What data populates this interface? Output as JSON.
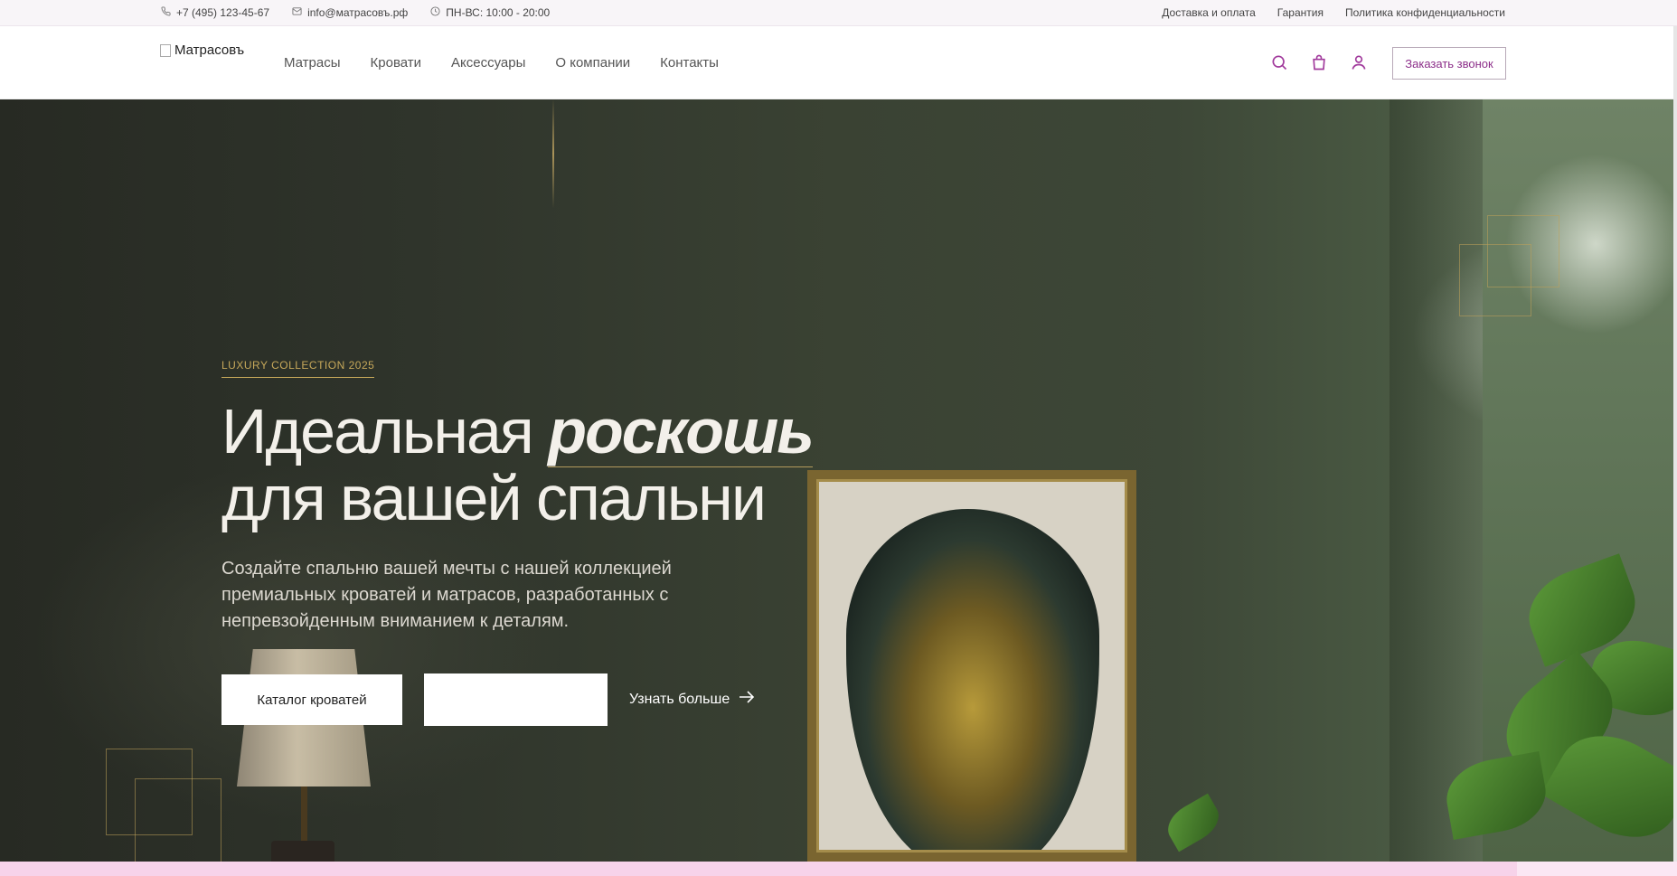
{
  "topbar": {
    "phone": "+7 (495) 123-45-67",
    "email": "info@матрасовъ.рф",
    "hours": "ПН-ВС: 10:00 - 20:00",
    "links": [
      "Доставка и оплата",
      "Гарантия",
      "Политика конфиденциальности"
    ]
  },
  "header": {
    "logo_alt": "Матрасовъ",
    "nav": [
      "Матрасы",
      "Кровати",
      "Аксессуары",
      "О компании",
      "Контакты"
    ],
    "icons": [
      "search-icon",
      "bag-icon",
      "user-icon"
    ],
    "call_button": "Заказать звонок"
  },
  "hero": {
    "badge": "LUXURY COLLECTION 2025",
    "title_part1": "Идеальная ",
    "title_accent": "роскошь",
    "title_part2": "для вашей спальни",
    "description": "Создайте спальню вашей мечты с нашей коллекцией премиальных кроватей и матрасов, разработанных с непревзойденным вниманием к деталям.",
    "button_catalog": "Каталог кроватей",
    "button_empty": "",
    "link_more": "Узнать больше"
  },
  "colors": {
    "accent": "#8d2f8a",
    "gold": "#c6a85a",
    "hero_dark": "#2f342b"
  }
}
